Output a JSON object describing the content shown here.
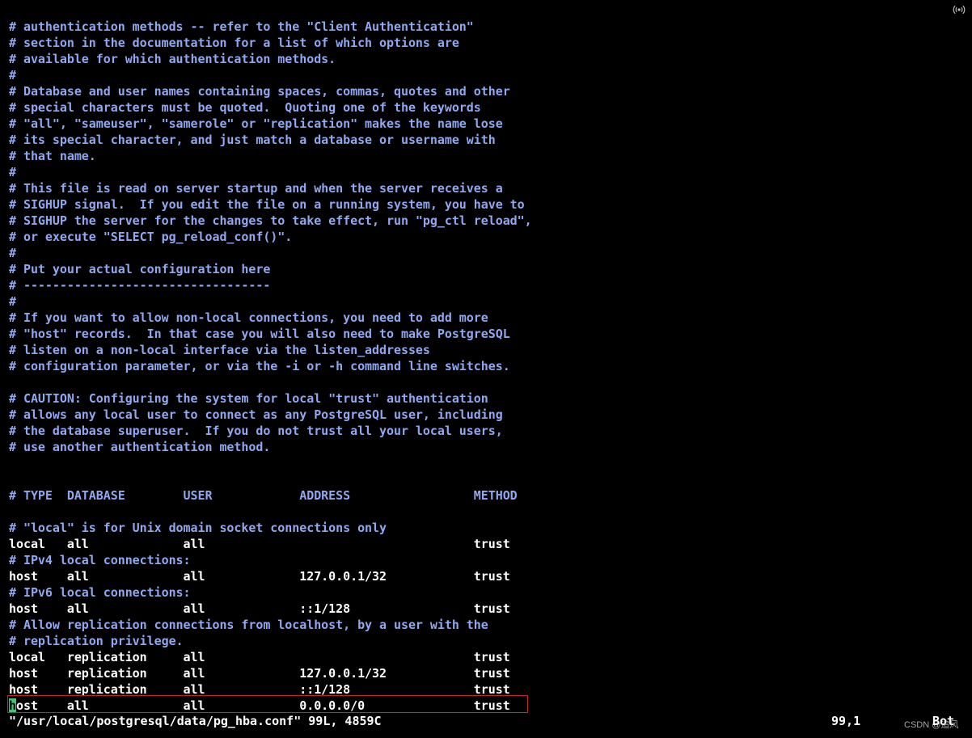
{
  "editor": {
    "lines": [
      {
        "text": "# authentication methods -- refer to the \"Client Authentication\"",
        "kind": "comment"
      },
      {
        "text": "# section in the documentation for a list of which options are",
        "kind": "comment"
      },
      {
        "text": "# available for which authentication methods.",
        "kind": "comment"
      },
      {
        "text": "#",
        "kind": "comment"
      },
      {
        "text": "# Database and user names containing spaces, commas, quotes and other",
        "kind": "comment"
      },
      {
        "text": "# special characters must be quoted.  Quoting one of the keywords",
        "kind": "comment"
      },
      {
        "text": "# \"all\", \"sameuser\", \"samerole\" or \"replication\" makes the name lose",
        "kind": "comment"
      },
      {
        "text": "# its special character, and just match a database or username with",
        "kind": "comment"
      },
      {
        "text": "# that name.",
        "kind": "comment"
      },
      {
        "text": "#",
        "kind": "comment"
      },
      {
        "text": "# This file is read on server startup and when the server receives a",
        "kind": "comment"
      },
      {
        "text": "# SIGHUP signal.  If you edit the file on a running system, you have to",
        "kind": "comment"
      },
      {
        "text": "# SIGHUP the server for the changes to take effect, run \"pg_ctl reload\",",
        "kind": "comment"
      },
      {
        "text": "# or execute \"SELECT pg_reload_conf()\".",
        "kind": "comment"
      },
      {
        "text": "#",
        "kind": "comment"
      },
      {
        "text": "# Put your actual configuration here",
        "kind": "comment"
      },
      {
        "text": "# ----------------------------------",
        "kind": "comment"
      },
      {
        "text": "#",
        "kind": "comment"
      },
      {
        "text": "# If you want to allow non-local connections, you need to add more",
        "kind": "comment"
      },
      {
        "text": "# \"host\" records.  In that case you will also need to make PostgreSQL",
        "kind": "comment"
      },
      {
        "text": "# listen on a non-local interface via the listen_addresses",
        "kind": "comment"
      },
      {
        "text": "# configuration parameter, or via the -i or -h command line switches.",
        "kind": "comment"
      },
      {
        "text": "",
        "kind": "comment"
      },
      {
        "text": "# CAUTION: Configuring the system for local \"trust\" authentication",
        "kind": "comment"
      },
      {
        "text": "# allows any local user to connect as any PostgreSQL user, including",
        "kind": "comment"
      },
      {
        "text": "# the database superuser.  If you do not trust all your local users,",
        "kind": "comment"
      },
      {
        "text": "# use another authentication method.",
        "kind": "comment"
      },
      {
        "text": "",
        "kind": "comment"
      },
      {
        "text": "",
        "kind": "comment"
      },
      {
        "text": "# TYPE  DATABASE        USER            ADDRESS                 METHOD",
        "kind": "comment"
      },
      {
        "text": "",
        "kind": "comment"
      },
      {
        "text": "# \"local\" is for Unix domain socket connections only",
        "kind": "comment"
      },
      {
        "text": "local   all             all                                     trust",
        "kind": "data"
      },
      {
        "text": "# IPv4 local connections:",
        "kind": "comment"
      },
      {
        "text": "host    all             all             127.0.0.1/32            trust",
        "kind": "data"
      },
      {
        "text": "# IPv6 local connections:",
        "kind": "comment"
      },
      {
        "text": "host    all             all             ::1/128                 trust",
        "kind": "data"
      },
      {
        "text": "# Allow replication connections from localhost, by a user with the",
        "kind": "comment"
      },
      {
        "text": "# replication privilege.",
        "kind": "comment"
      },
      {
        "text": "local   replication     all                                     trust",
        "kind": "data"
      },
      {
        "text": "host    replication     all             127.0.0.1/32            trust",
        "kind": "data"
      },
      {
        "text": "host    replication     all             ::1/128                 trust",
        "kind": "data"
      }
    ],
    "cursor_line": {
      "cursor_char": "h",
      "rest": "ost    all             all             0.0.0.0/0               trust"
    }
  },
  "status_bar": {
    "file_info": "\"/usr/local/postgresql/data/pg_hba.conf\" 99L, 4859C",
    "position": "99,1",
    "scroll": "Bot"
  },
  "watermark": "CSDN @追风",
  "colors": {
    "background": "#000000",
    "comment": "#8fa8f0",
    "text": "#ffffff",
    "cursor": "#3ac776",
    "highlight_border": "#c8232c"
  },
  "icons": {
    "top_right": "broadcast-icon"
  }
}
